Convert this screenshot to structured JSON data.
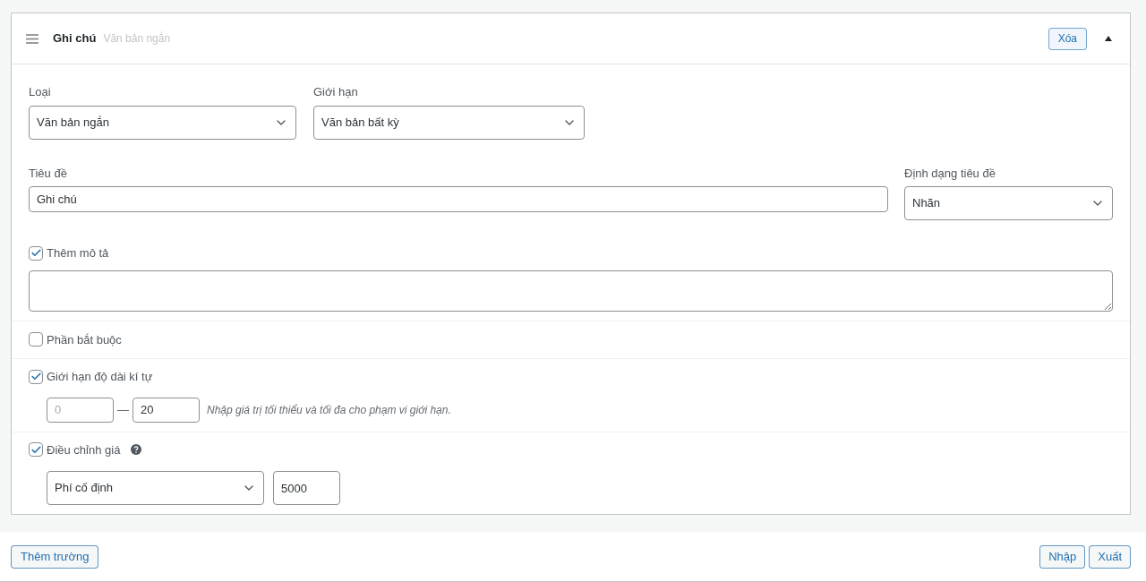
{
  "field": {
    "title": "Ghi chú",
    "type_label": "Văn bản ngắn",
    "expanded": true,
    "delete_button": "Xóa"
  },
  "type_select": {
    "label": "Loại",
    "value": "Văn bản ngắn"
  },
  "restriction_select": {
    "label": "Giới hạn",
    "value": "Văn bản bất kỳ"
  },
  "title_field": {
    "label": "Tiêu đề",
    "value": "Ghi chú"
  },
  "title_format_select": {
    "label": "Định dạng tiêu đề",
    "value": "Nhãn"
  },
  "description": {
    "label": "Thêm mô tả",
    "checked": true
  },
  "required": {
    "label": "Phần bắt buộc",
    "checked": false
  },
  "char_limit": {
    "label": "Giới hạn độ dài kí tự",
    "checked": true,
    "min": {
      "placeholder": "0"
    },
    "separator": "—",
    "max": {
      "value": "20"
    },
    "hint": "Nhập giá trị tối thiểu và tối đa cho phạm vi giới hạn."
  },
  "price_adjust": {
    "label": "Điều chỉnh giá",
    "checked": true,
    "fee_select": {
      "value": "Phí cố định"
    },
    "amount": {
      "value": "5000"
    }
  },
  "footer": {
    "add_button": "Thêm trường",
    "buttons": [
      "Nhập",
      "Xuất"
    ]
  }
}
